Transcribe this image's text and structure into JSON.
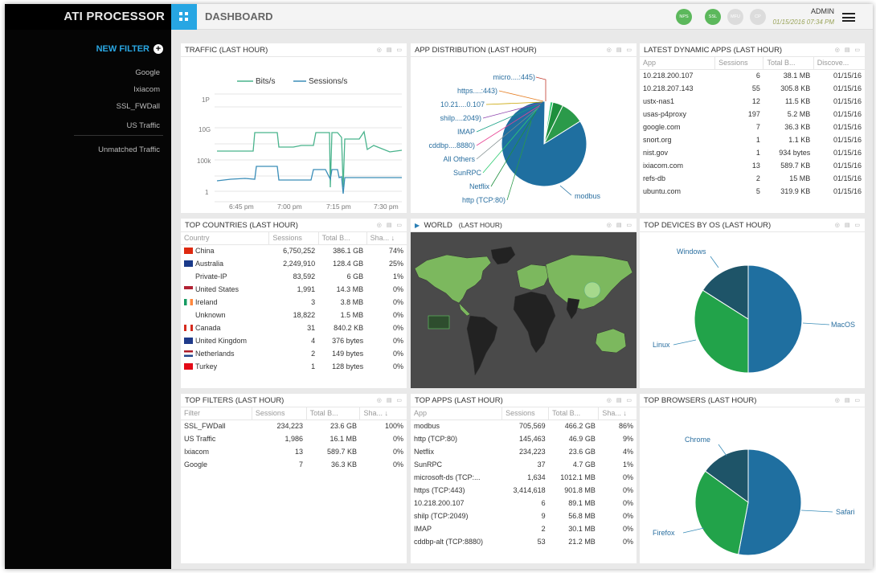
{
  "brand": "ATI PROCESSOR",
  "topbar": {
    "title": "DASHBOARD",
    "stats": [
      {
        "label": "NPS",
        "color": "#5cb85c"
      },
      {
        "label": "SSL",
        "color": "#5cb85c"
      },
      {
        "label": "MFU",
        "color": "#dcdcdc"
      },
      {
        "label": "CP",
        "color": "#dcdcdc"
      }
    ],
    "user": "ADMIN",
    "timestamp": "01/15/2016 07:34 PM"
  },
  "sidebar": {
    "new_filter": "NEW FILTER",
    "filters": [
      "Google",
      "Ixiacom",
      "SSL_FWDall",
      "US Traffic"
    ],
    "unmatched": "Unmatched Traffic"
  },
  "panels": {
    "traffic": {
      "title": "TRAFFIC (LAST HOUR)"
    },
    "appdist": {
      "title": "APP DISTRIBUTION (LAST HOUR)"
    },
    "latest": {
      "title": "LATEST DYNAMIC APPS (LAST HOUR)",
      "columns": [
        "App",
        "Sessions",
        "Total B...",
        "Discove..."
      ],
      "rows": [
        [
          "10.218.200.107",
          "6",
          "38.1 MB",
          "01/15/16"
        ],
        [
          "10.218.207.143",
          "55",
          "305.8 KB",
          "01/15/16"
        ],
        [
          "ustx-nas1",
          "12",
          "11.5 KB",
          "01/15/16"
        ],
        [
          "usas-p4proxy",
          "197",
          "5.2 MB",
          "01/15/16"
        ],
        [
          "google.com",
          "7",
          "36.3 KB",
          "01/15/16"
        ],
        [
          "snort.org",
          "1",
          "1.1 KB",
          "01/15/16"
        ],
        [
          "nist.gov",
          "1",
          "934 bytes",
          "01/15/16"
        ],
        [
          "ixiacom.com",
          "13",
          "589.7 KB",
          "01/15/16"
        ],
        [
          "refs-db",
          "2",
          "15 MB",
          "01/15/16"
        ],
        [
          "ubuntu.com",
          "5",
          "319.9 KB",
          "01/15/16"
        ]
      ]
    },
    "countries": {
      "title": "TOP COUNTRIES (LAST HOUR)",
      "columns": [
        "Country",
        "Sessions",
        "Total B...",
        "Sha..."
      ],
      "rows": [
        [
          "China",
          "6,750,252",
          "386.1 GB",
          "74%",
          "cn"
        ],
        [
          "Australia",
          "2,249,910",
          "128.4 GB",
          "25%",
          "au"
        ],
        [
          "Private-IP",
          "83,592",
          "6 GB",
          "1%",
          ""
        ],
        [
          "United States",
          "1,991",
          "14.3 MB",
          "0%",
          "us"
        ],
        [
          "Ireland",
          "3",
          "3.8 MB",
          "0%",
          "ie"
        ],
        [
          "Unknown",
          "18,822",
          "1.5 MB",
          "0%",
          ""
        ],
        [
          "Canada",
          "31",
          "840.2 KB",
          "0%",
          "ca"
        ],
        [
          "United Kingdom",
          "4",
          "376 bytes",
          "0%",
          "gb"
        ],
        [
          "Netherlands",
          "2",
          "149 bytes",
          "0%",
          "nl"
        ],
        [
          "Turkey",
          "1",
          "128 bytes",
          "0%",
          "tr"
        ]
      ]
    },
    "world": {
      "title": "WORLD",
      "subtitle": "(LAST HOUR)"
    },
    "devices": {
      "title": "TOP DEVICES BY OS (LAST HOUR)"
    },
    "filters": {
      "title": "TOP FILTERS (LAST HOUR)",
      "columns": [
        "Filter",
        "Sessions",
        "Total B...",
        "Sha..."
      ],
      "rows": [
        [
          "SSL_FWDall",
          "234,223",
          "23.6 GB",
          "100%"
        ],
        [
          "US Traffic",
          "1,986",
          "16.1 MB",
          "0%"
        ],
        [
          "Ixiacom",
          "13",
          "589.7 KB",
          "0%"
        ],
        [
          "Google",
          "7",
          "36.3 KB",
          "0%"
        ]
      ]
    },
    "apps": {
      "title": "TOP APPS (LAST HOUR)",
      "columns": [
        "App",
        "Sessions",
        "Total B...",
        "Sha..."
      ],
      "rows": [
        [
          "modbus",
          "705,569",
          "466.2 GB",
          "86%"
        ],
        [
          "http (TCP:80)",
          "145,463",
          "46.9 GB",
          "9%"
        ],
        [
          "Netflix",
          "234,223",
          "23.6 GB",
          "4%"
        ],
        [
          "SunRPC",
          "37",
          "4.7 GB",
          "1%"
        ],
        [
          "microsoft-ds (TCP:...",
          "1,634",
          "1012.1 MB",
          "0%"
        ],
        [
          "https (TCP:443)",
          "3,414,618",
          "901.8 MB",
          "0%"
        ],
        [
          "10.218.200.107",
          "6",
          "89.1 MB",
          "0%"
        ],
        [
          "shilp (TCP:2049)",
          "9",
          "56.8 MB",
          "0%"
        ],
        [
          "IMAP",
          "2",
          "30.1 MB",
          "0%"
        ],
        [
          "cddbp-alt (TCP:8880)",
          "53",
          "21.2 MB",
          "0%"
        ]
      ]
    },
    "browsers": {
      "title": "TOP BROWSERS (LAST HOUR)"
    }
  },
  "chart_data": [
    {
      "type": "line",
      "title": "TRAFFIC (LAST HOUR)",
      "legend": [
        "Bits/s",
        "Sessions/s"
      ],
      "x": [
        "6:45 pm",
        "7:00 pm",
        "7:15 pm",
        "7:30 pm"
      ],
      "yticks": [
        "1P",
        "10G",
        "100k",
        "1"
      ],
      "series": [
        {
          "name": "Bits/s",
          "color": "#49b38c"
        },
        {
          "name": "Sessions/s",
          "color": "#3a8db8"
        }
      ]
    },
    {
      "type": "pie",
      "title": "APP DISTRIBUTION (LAST HOUR)",
      "labels": [
        "micro....:445)",
        "https....:443)",
        "10.21....0.107",
        "shilp....2049)",
        "IMAP",
        "cddbp....8880)",
        "All Others",
        "SunRPC",
        "Netflix",
        "http (TCP:80)",
        "modbus"
      ],
      "values": [
        0.3,
        0.3,
        0.3,
        0.3,
        0.3,
        0.3,
        0.3,
        1,
        4,
        9,
        86
      ]
    },
    {
      "type": "pie",
      "title": "TOP DEVICES BY OS (LAST HOUR)",
      "labels": [
        "MacOS",
        "Linux",
        "Windows"
      ],
      "values": [
        50,
        34,
        16
      ]
    },
    {
      "type": "pie",
      "title": "TOP BROWSERS (LAST HOUR)",
      "labels": [
        "Safari",
        "Firefox",
        "Chrome"
      ],
      "values": [
        53,
        32,
        15
      ]
    }
  ]
}
